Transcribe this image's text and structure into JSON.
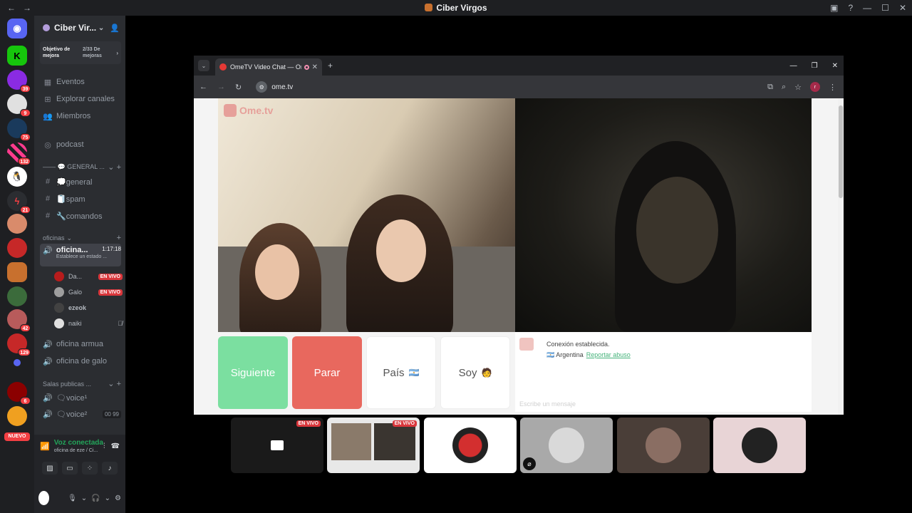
{
  "app": {
    "title": "Ciber Virgos"
  },
  "guilds": {
    "badges": [
      "39",
      "9",
      "75",
      "132",
      "21",
      "129",
      "6",
      "42"
    ],
    "nuevo_label": "NUEVO"
  },
  "server": {
    "name": "Ciber Vir...",
    "goal_title": "Objetivo de mejora",
    "goal_progress": "2/33 De mejoras"
  },
  "nav": {
    "events": "Eventos",
    "browse": "Explorar canales",
    "members": "Miembros",
    "podcast": "podcast"
  },
  "categories": {
    "general": "—— 💬 GENERAL ...",
    "oficinas": "oficinas",
    "salas": "Salas publicas ..."
  },
  "channels": {
    "general": "💭general",
    "spam": "🧻spam",
    "comandos": "🔧comandos",
    "oficina_active": "oficina...",
    "oficina_time": "1:17:18",
    "oficina_status": "Establece un estado ...",
    "oficina_armua": "oficina armua",
    "oficina_galo": "oficina de galo",
    "voice1": "🗨voice¹",
    "voice2": "🗨voice²",
    "voice2_count_a": "00",
    "voice2_count_b": "99"
  },
  "voice_users": [
    {
      "name": "Da...",
      "live": "EN VIVO"
    },
    {
      "name": "Galo",
      "live": "EN VIVO"
    },
    {
      "name": "ezeok",
      "live": ""
    },
    {
      "name": "naiki",
      "live": ""
    }
  ],
  "voice_panel": {
    "status": "Voz conectada",
    "sub": "oficina de eze / Ci..."
  },
  "browser": {
    "tab_title": "OmeTV Video Chat — Ome",
    "url": "ome.tv",
    "profile_letter": "r"
  },
  "ometv": {
    "logo": "Ome.tv",
    "btn_next": "Siguiente",
    "btn_stop": "Parar",
    "btn_country": "País",
    "btn_me": "Soy",
    "status": "Conexión establecida.",
    "country": "Argentina",
    "report": "Reportar abuso",
    "input_placeholder": "Escribe un mensaje"
  },
  "tiles": {
    "live_label": "EN VIVO"
  },
  "colors": {
    "discord_bg": "#2b2d31",
    "accent_green": "#23a55a",
    "live_red": "#da373c",
    "next_green": "#7bdfa0",
    "stop_red": "#e8685e"
  }
}
